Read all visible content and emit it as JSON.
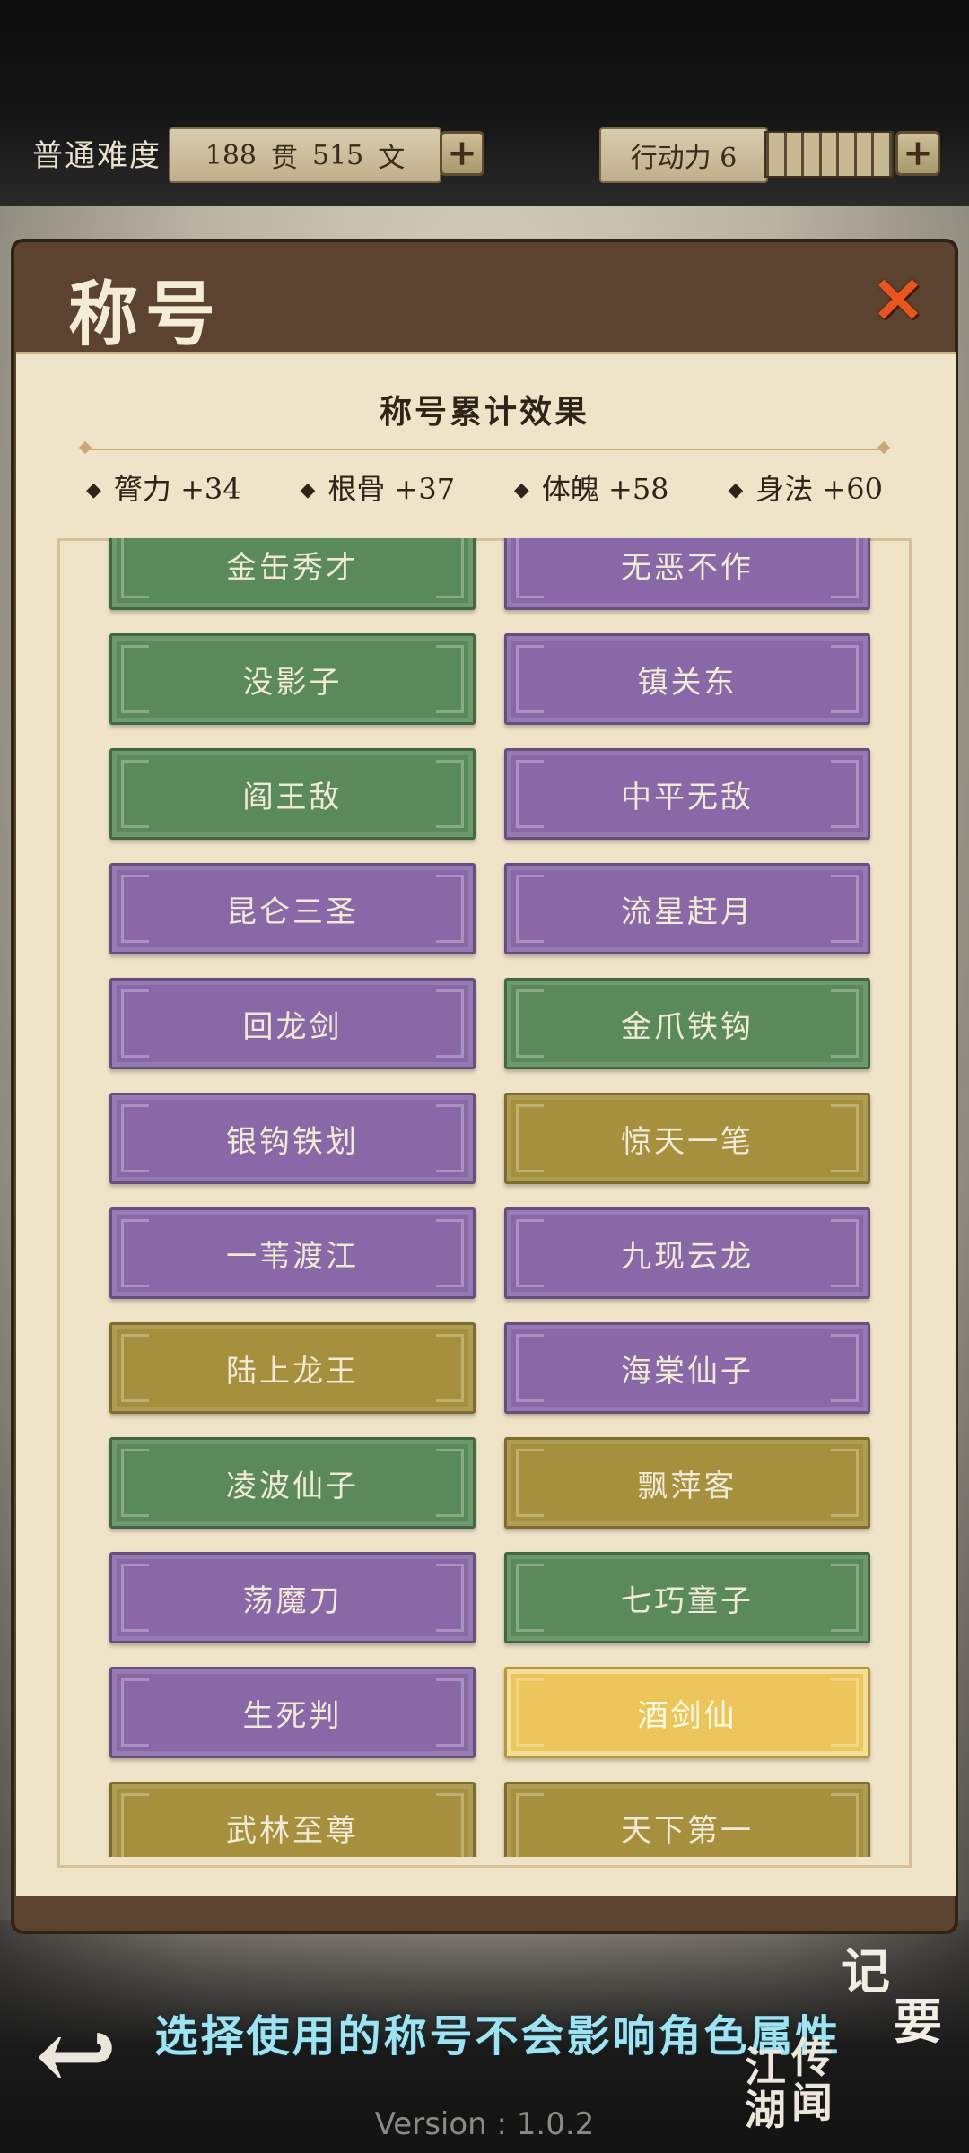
{
  "header": {
    "difficulty": "普通难度",
    "money_guan": "188",
    "money_guan_unit": "贯",
    "money_wen": "515",
    "money_wen_unit": "文",
    "action_label": "行动力 6",
    "action_segments": 7
  },
  "panel": {
    "title": "称号",
    "close_icon": "close-x-icon",
    "summary_title": "称号累计效果",
    "stats": [
      {
        "label": "膂力 +34"
      },
      {
        "label": "根骨 +37"
      },
      {
        "label": "体魄 +58"
      },
      {
        "label": "身法 +60"
      }
    ]
  },
  "titles": [
    {
      "label": "金缶秀才",
      "color": "green"
    },
    {
      "label": "无恶不作",
      "color": "purple"
    },
    {
      "label": "没影子",
      "color": "green"
    },
    {
      "label": "镇关东",
      "color": "purple"
    },
    {
      "label": "阎王敌",
      "color": "green"
    },
    {
      "label": "中平无敌",
      "color": "purple"
    },
    {
      "label": "昆仑三圣",
      "color": "purple"
    },
    {
      "label": "流星赶月",
      "color": "purple"
    },
    {
      "label": "回龙剑",
      "color": "purple"
    },
    {
      "label": "金爪铁钩",
      "color": "green"
    },
    {
      "label": "银钩铁划",
      "color": "purple"
    },
    {
      "label": "惊天一笔",
      "color": "gold"
    },
    {
      "label": "一苇渡江",
      "color": "purple"
    },
    {
      "label": "九现云龙",
      "color": "purple"
    },
    {
      "label": "陆上龙王",
      "color": "gold"
    },
    {
      "label": "海棠仙子",
      "color": "purple"
    },
    {
      "label": "凌波仙子",
      "color": "green"
    },
    {
      "label": "飘萍客",
      "color": "gold"
    },
    {
      "label": "荡魔刀",
      "color": "purple"
    },
    {
      "label": "七巧童子",
      "color": "green"
    },
    {
      "label": "生死判",
      "color": "purple"
    },
    {
      "label": "酒剑仙",
      "color": "selected"
    },
    {
      "label": "武林至尊",
      "color": "gold"
    },
    {
      "label": "天下第一",
      "color": "gold"
    }
  ],
  "footer": {
    "hint": "选择使用的称号不会影响角色属性",
    "back_icon": "back-arrow-icon",
    "notes_label": "记要",
    "rumors_label": "江湖传闻",
    "version": "Version : 1.0.2"
  },
  "colors": {
    "green": "#5b8a5a",
    "purple": "#8a68a8",
    "gold": "#a6903e",
    "selected": "#ecc65a",
    "hint_text": "#9fe3f2"
  }
}
